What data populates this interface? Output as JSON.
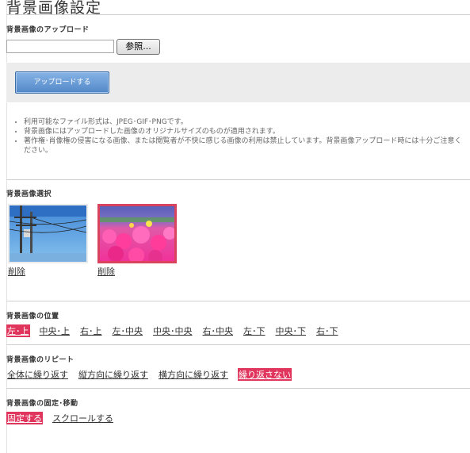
{
  "page_title": "背景画像設定",
  "upload": {
    "section_label": "背景画像のアップロード",
    "file_value": "",
    "browse_label": "参照...",
    "upload_button_label": "アップロードする"
  },
  "notes": [
    "利用可能なファイル形式は、JPEG･GIF･PNGです。",
    "背景画像にはアップロードした画像のオリジナルサイズのものが適用されます。",
    "著作権･肖像権の侵害になる画像、または閲覧者が不快に感じる画像の利用は禁止しています。背景画像アップロード時には十分ご注意ください。"
  ],
  "selection": {
    "section_label": "背景画像選択",
    "images": [
      {
        "delete_label": "削除",
        "selected": false
      },
      {
        "delete_label": "削除",
        "selected": true
      }
    ]
  },
  "position": {
    "section_label": "背景画像の位置",
    "options": [
      "左･上",
      "中央･上",
      "右･上",
      "左･中央",
      "中央･中央",
      "右･中央",
      "左･下",
      "中央･下",
      "右･下"
    ],
    "selected": "左･上"
  },
  "repeat": {
    "section_label": "背景画像のリピート",
    "options": [
      "全体に繰り返す",
      "縦方向に繰り返す",
      "横方向に繰り返す",
      "繰り返さない"
    ],
    "selected": "繰り返さない"
  },
  "attachment": {
    "section_label": "背景画像の固定･移動",
    "options": [
      "固定する",
      "スクロールする"
    ],
    "selected": "固定する"
  },
  "colors": {
    "accent": "#e0355d",
    "upload_button": "#5288c8",
    "panel_bg": "#ececec"
  }
}
